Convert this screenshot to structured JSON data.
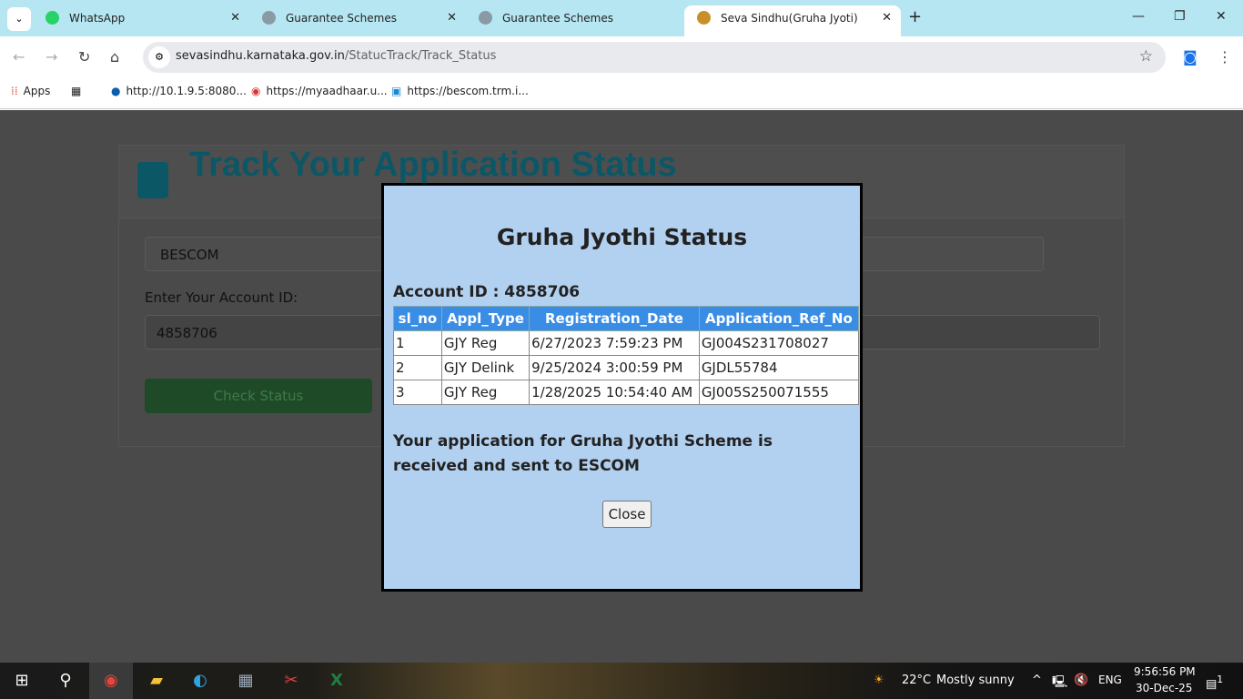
{
  "browser": {
    "tabs": [
      {
        "title": "WhatsApp",
        "icon": "whatsapp-icon"
      },
      {
        "title": "Guarantee Schemes",
        "icon": "globe-icon"
      },
      {
        "title": "Guarantee Schemes",
        "icon": "globe-icon"
      },
      {
        "title": "Seva Sindhu(Gruha Jyoti)",
        "icon": "karnataka-emblem-icon",
        "active": true
      }
    ],
    "url_host": "sevasindhu.karnataka.gov.in",
    "url_path": "/StatucTrack/Track_Status",
    "bookmarks": [
      "Apps",
      "http://10.1.9.5:8080...",
      "https://myaadhaar.u...",
      "https://bescom.trm.i..."
    ]
  },
  "page": {
    "title": "Track Your Application Status",
    "escom": "BESCOM",
    "account_label": "Enter Your Account ID:",
    "account_value": "4858706",
    "check_button": "Check Status"
  },
  "modal": {
    "title": "Gruha Jyothi Status",
    "account": "Account ID : 4858706",
    "columns": [
      "sl_no",
      "Appl_Type",
      "Registration_Date",
      "Application_Ref_No"
    ],
    "rows": [
      [
        "1",
        "GJY Reg",
        "6/27/2023 7:59:23 PM",
        "GJ004S231708027"
      ],
      [
        "2",
        "GJY Delink",
        "9/25/2024 3:00:59 PM",
        "GJDL55784"
      ],
      [
        "3",
        "GJY Reg",
        "1/28/2025 10:54:40 AM",
        "GJ005S250071555"
      ]
    ],
    "message": "Your application for Gruha Jyothi Scheme is received and sent to ESCOM",
    "close": "Close",
    "header_color": "#3a8de5",
    "background": "#b2d0ef"
  },
  "taskbar": {
    "weather": "22°C",
    "weather_desc": "Mostly sunny",
    "lang": "ENG",
    "time": "9:56:56 PM",
    "date": "30-Dec-25",
    "notifications": "1"
  }
}
